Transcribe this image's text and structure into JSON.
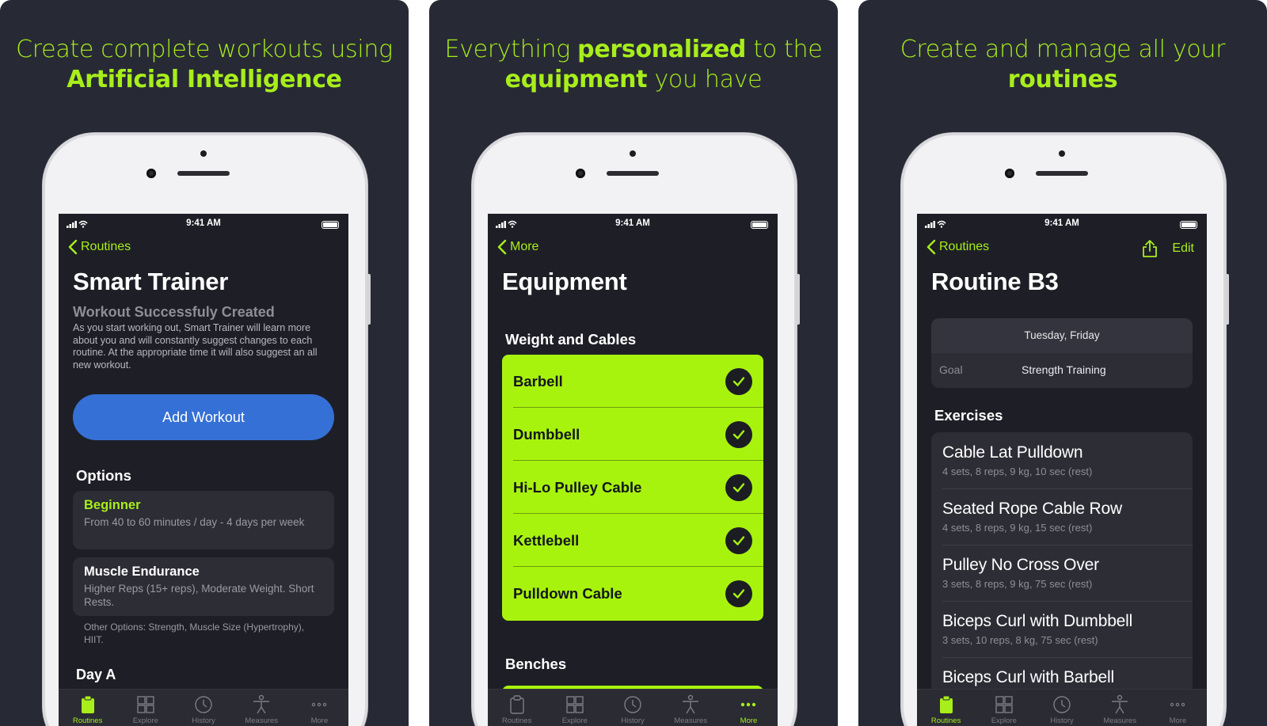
{
  "colors": {
    "accent": "#a8ee1b",
    "panel_bg": "#272a35",
    "screen_bg": "#1e1f26",
    "button_blue": "#3570d6"
  },
  "status_bar": {
    "time": "9:41 AM"
  },
  "tab_bar": {
    "items": [
      {
        "label": "Routines",
        "icon": "clipboard-icon"
      },
      {
        "label": "Explore",
        "icon": "grid-icon"
      },
      {
        "label": "History",
        "icon": "clock-history-icon"
      },
      {
        "label": "Measures",
        "icon": "body-figure-icon"
      },
      {
        "label": "More",
        "icon": "more-dots-icon"
      }
    ]
  },
  "panels": [
    {
      "headline": {
        "line1": "Create complete workouts using",
        "line2_bold": "Artificial Intelligence"
      },
      "back_label": "Routines",
      "title": "Smart Trainer",
      "subtitle": "Workout Successfuly Created",
      "description": "As you start working out, Smart Trainer will learn more about you and will constantly suggest changes to each routine. At the appropriate time it will also suggest an all new workout.",
      "primary_button": "Add Workout",
      "options_header": "Options",
      "options": [
        {
          "title": "Beginner",
          "detail": "From 40 to 60 minutes / day - 4 days per week"
        },
        {
          "title": "Muscle Endurance",
          "detail": "Higher Reps (15+ reps), Moderate Weight. Short Rests."
        }
      ],
      "other_options": "Other Options: Strength, Muscle Size (Hypertrophy), HIIT.",
      "cut_off_text": "Day A",
      "active_tab": 0
    },
    {
      "headline": {
        "l1_pre": "Everything ",
        "l1_bold": "personalized",
        "l1_post": " to the",
        "l2_bold": "equipment",
        "l2_post": " you have"
      },
      "back_label": "More",
      "title": "Equipment",
      "section_header": "Weight and Cables",
      "equipment": [
        "Barbell",
        "Dumbbell",
        "Hi-Lo Pulley Cable",
        "Kettlebell",
        "Pulldown Cable"
      ],
      "section_header_2": "Benches",
      "active_tab": 4
    },
    {
      "headline": {
        "line1": "Create and manage all your",
        "line2_bold": "routines"
      },
      "back_label": "Routines",
      "edit_label": "Edit",
      "title": "Routine B3",
      "schedule_days": "Tuesday, Friday",
      "goal_label": "Goal",
      "goal_value": "Strength Training",
      "exercises_header": "Exercises",
      "exercises": [
        {
          "name": "Cable Lat Pulldown",
          "detail": "4 sets, 8 reps, 9 kg, 10 sec (rest)"
        },
        {
          "name": "Seated Rope Cable Row",
          "detail": "4 sets, 8 reps, 9 kg, 15 sec (rest)"
        },
        {
          "name": "Pulley No Cross Over",
          "detail": "3 sets, 8 reps, 9 kg, 75 sec (rest)"
        },
        {
          "name": "Biceps Curl with Dumbbell",
          "detail": "3 sets, 10 reps, 8 kg, 75 sec (rest)"
        },
        {
          "name": "Biceps Curl with Barbell",
          "detail": ""
        }
      ],
      "active_tab": 0
    }
  ]
}
